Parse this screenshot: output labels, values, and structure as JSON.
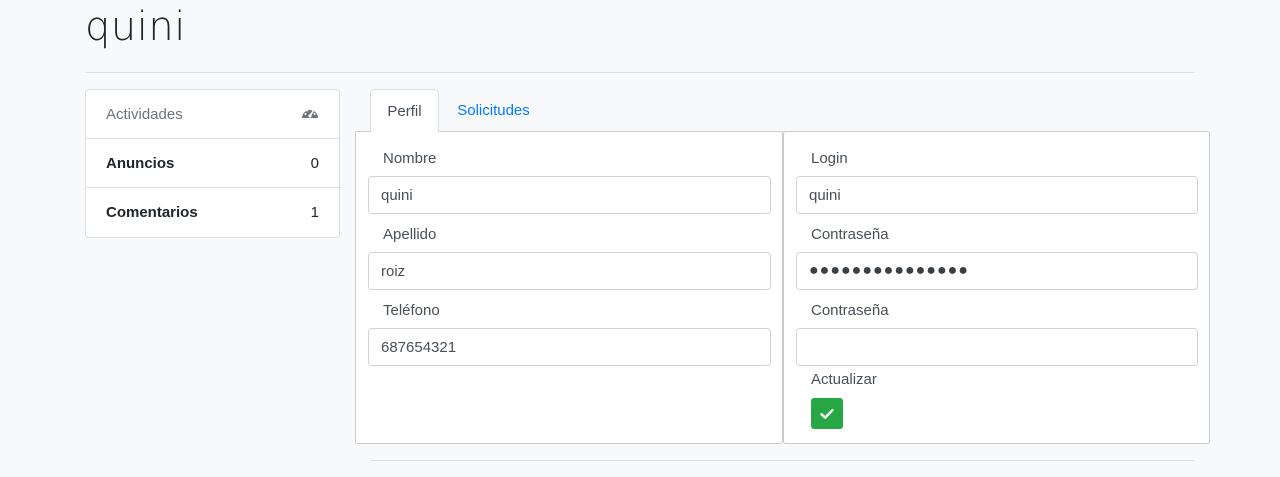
{
  "header": {
    "title": "quini"
  },
  "sidebar": {
    "heading": "Actividades",
    "heading_icon": "dashboard-icon",
    "items": [
      {
        "label": "Anuncios",
        "count": "0"
      },
      {
        "label": "Comentarios",
        "count": "1"
      }
    ]
  },
  "tabs": [
    {
      "label": "Perfil",
      "active": true
    },
    {
      "label": "Solicitudes",
      "active": false
    }
  ],
  "profile": {
    "nombre_label": "Nombre",
    "nombre_value": "quini",
    "apellido_label": "Apellido",
    "apellido_value": "roiz",
    "telefono_label": "Teléfono",
    "telefono_value": "687654321"
  },
  "account": {
    "login_label": "Login",
    "login_value": "quini",
    "password_label": "Contraseña",
    "password_value": "●●●●●●●●●●●●●●●",
    "password2_label": "Contraseña",
    "password2_value": "",
    "update_label": "Actualizar",
    "update_icon": "check-icon"
  },
  "colors": {
    "link": "#007bff",
    "update_button": "#28a745",
    "background": "#f8f9fa"
  }
}
